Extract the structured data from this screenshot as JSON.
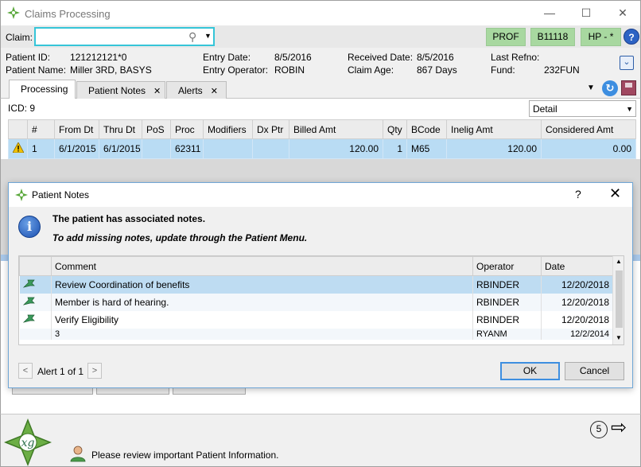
{
  "window": {
    "title": "Claims Processing",
    "minimize": "—",
    "maximize": "☐",
    "close": "✕"
  },
  "claim_bar": {
    "label": "Claim:",
    "input_value": "",
    "buttons": [
      "PROF",
      "B11118",
      "HP - *"
    ],
    "help": "?"
  },
  "patient_info": {
    "patient_id_label": "Patient ID:",
    "patient_id": "121212121*0",
    "patient_name_label": "Patient Name:",
    "patient_name": "Miller 3RD, BASYS",
    "entry_date_label": "Entry Date:",
    "entry_date": "8/5/2016",
    "entry_operator_label": "Entry Operator:",
    "entry_operator": "ROBIN",
    "received_date_label": "Received Date:",
    "received_date": "8/5/2016",
    "claim_age_label": "Claim Age:",
    "claim_age": "867 Days",
    "last_refno_label": "Last Refno:",
    "last_refno": "",
    "fund_label": "Fund:",
    "fund": "232FUN"
  },
  "tabs": [
    {
      "label": "Processing",
      "closable": false
    },
    {
      "label": "Patient Notes",
      "closable": true
    },
    {
      "label": "Alerts",
      "closable": true
    }
  ],
  "tab_close": "✕",
  "processing": {
    "icd": "ICD: 9",
    "view_select": "Detail",
    "columns": [
      "",
      "#",
      "From Dt",
      "Thru Dt",
      "PoS",
      "Proc",
      "Modifiers",
      "Dx Ptr",
      "Billed Amt",
      "Qty",
      "BCode",
      "Inelig Amt",
      "Considered Amt"
    ],
    "rows": [
      {
        "num": "1",
        "from": "6/1/2015",
        "thru": "6/1/2015",
        "pos": "",
        "proc": "62311",
        "modifiers": "",
        "dx_ptr": "",
        "billed": "120.00",
        "qty": "1",
        "bcode": "M65",
        "inelig": "120.00",
        "considered": "0.00"
      }
    ]
  },
  "dialog": {
    "title": "Patient Notes",
    "help": "?",
    "close": "✕",
    "message_title": "The patient has associated notes.",
    "message_detail": "To add missing notes, update through the Patient Menu.",
    "columns": [
      "",
      "Comment",
      "Operator",
      "Date"
    ],
    "notes": [
      {
        "comment": "Review Coordination of benefits",
        "operator": "RBINDER",
        "date": "12/20/2018"
      },
      {
        "comment": "Member is hard of hearing.",
        "operator": "RBINDER",
        "date": "12/20/2018"
      },
      {
        "comment": "Verify Eligibility",
        "operator": "RBINDER",
        "date": "12/20/2018"
      },
      {
        "comment": "3",
        "operator": "RYANM",
        "date": "12/2/2014"
      }
    ],
    "alert_counter": "Alert 1 of 1",
    "prev": "<",
    "next": ">",
    "ok": "OK",
    "cancel": "Cancel"
  },
  "footer": {
    "page_count": "5",
    "status_message": "Please review important Patient Information."
  },
  "colors": {
    "accent": "#35c5d8",
    "header_green": "#a8d8a0",
    "selection_blue": "#b9dcf4",
    "info_blue": "#1a4fb0"
  }
}
